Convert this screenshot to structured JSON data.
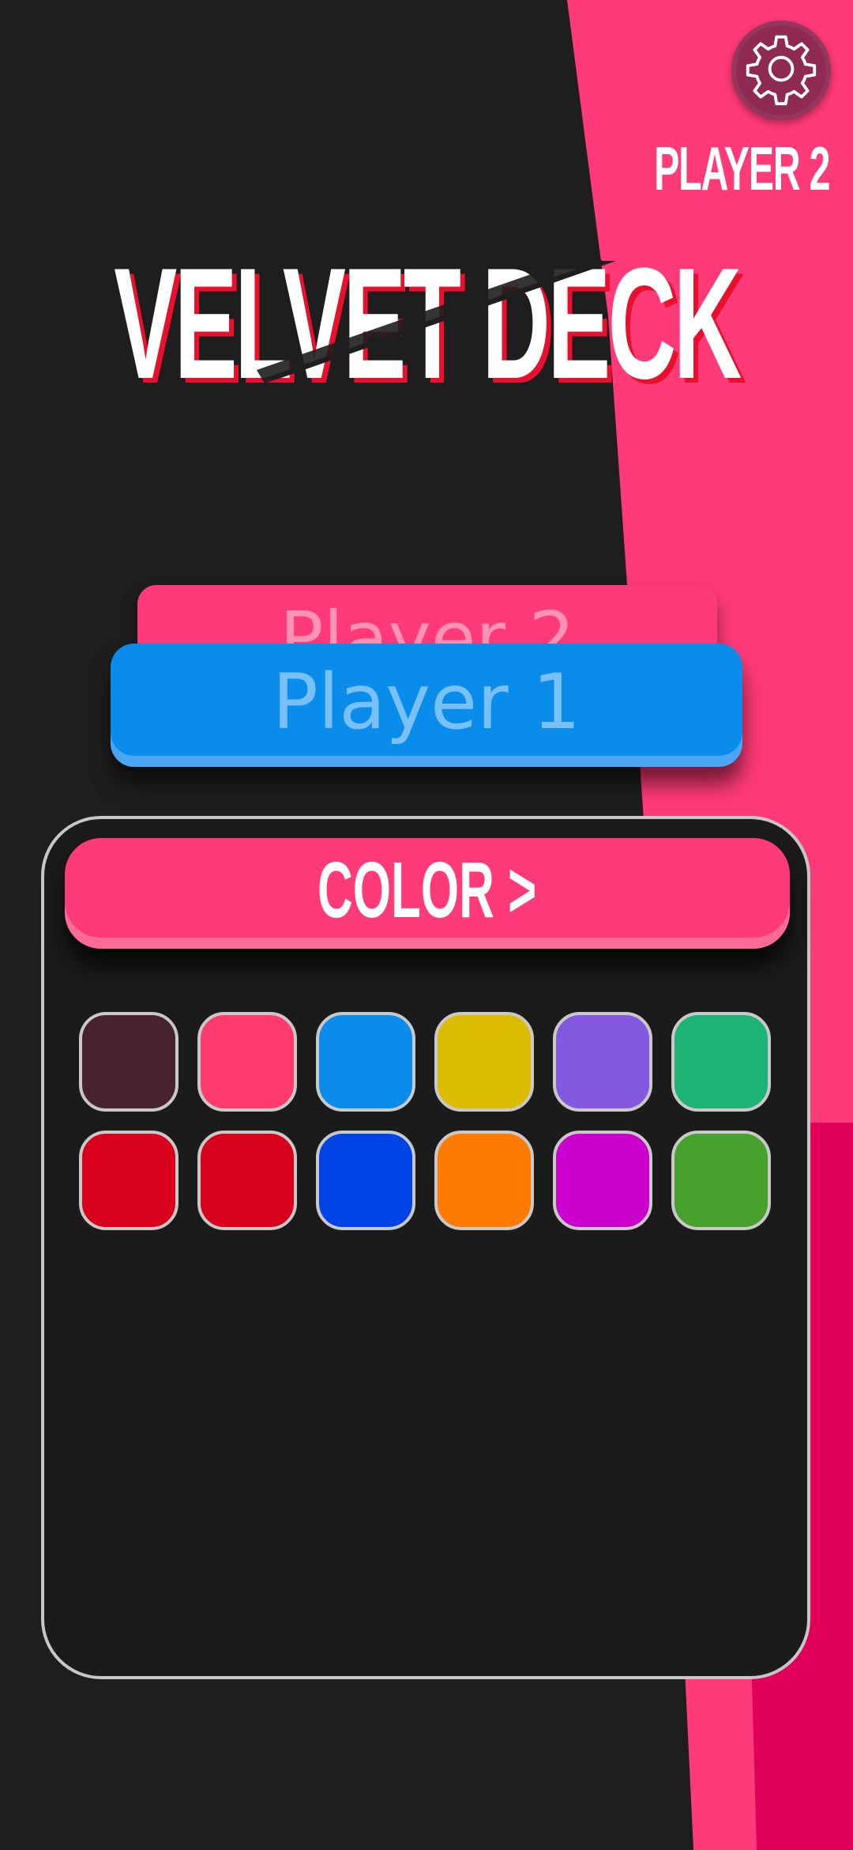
{
  "app": {
    "title": "VELVET DECK",
    "turn_label": "PLAYER 2",
    "settings_icon": "gear-icon"
  },
  "players": {
    "back_label": "Player 2",
    "front_label": "Player 1"
  },
  "panel": {
    "header_label": "COLOR >"
  },
  "colors": {
    "background": "#1e1e1e",
    "accent_pink": "#ff3a78",
    "accent_blue": "#0a8ceb",
    "deep_pink": "#e0005a",
    "swatches": [
      "#46232f",
      "#ff3a6e",
      "#0a8ceb",
      "#dcbc00",
      "#8459e0",
      "#1db377",
      "#d9001d",
      "#d9001d",
      "#0044e6",
      "#ff7a00",
      "#cc00cc",
      "#46a22c"
    ]
  }
}
